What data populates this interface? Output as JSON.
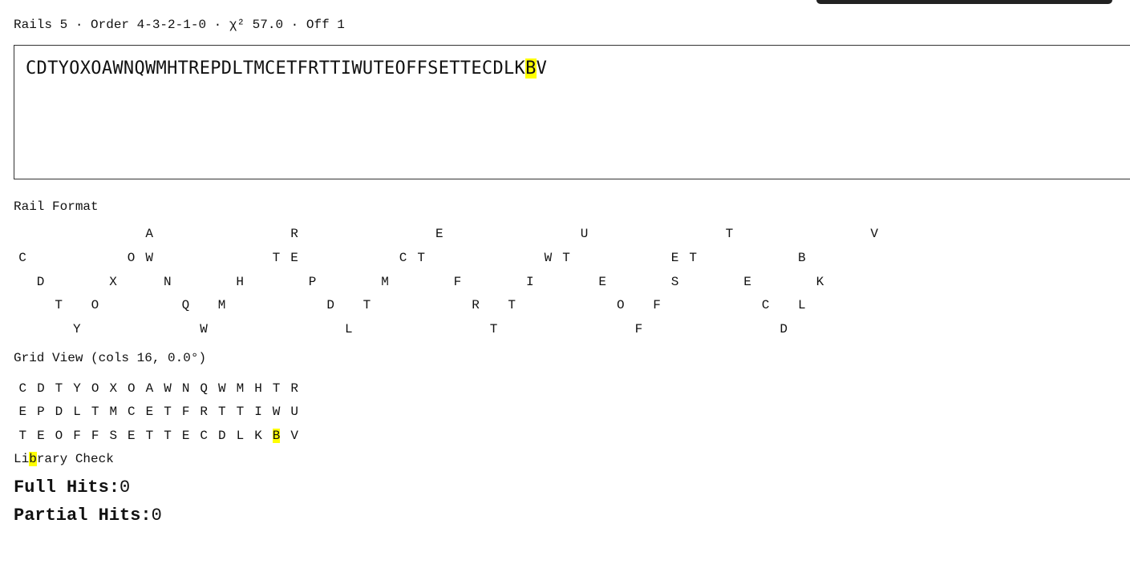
{
  "status": {
    "text": "Rails 5 · Order 4-3-2-1-0 · χ² 57.0 · Off 1"
  },
  "ciphertext": {
    "before": "CDTYOXOAWNQWMHTREPDLTMCETFRTTIWUTEOFFSETTECDLK",
    "highlight": "B",
    "after": "V"
  },
  "rail_format": {
    "label": "Rail Format",
    "rails": [
      [
        null,
        null,
        null,
        null,
        null,
        null,
        null,
        "A",
        null,
        null,
        null,
        null,
        null,
        null,
        null,
        "R",
        null,
        null,
        null,
        null,
        null,
        null,
        null,
        "E",
        null,
        null,
        null,
        null,
        null,
        null,
        null,
        "U",
        null,
        null,
        null,
        null,
        null,
        null,
        null,
        "T",
        null,
        null,
        null,
        null,
        null,
        null,
        null,
        "V"
      ],
      [
        "C",
        null,
        null,
        null,
        null,
        null,
        "O",
        "W",
        null,
        null,
        null,
        null,
        null,
        null,
        "T",
        "E",
        null,
        null,
        null,
        null,
        null,
        "C",
        "T",
        null,
        null,
        null,
        null,
        null,
        null,
        "W",
        "T",
        null,
        null,
        null,
        null,
        null,
        "E",
        "T",
        null,
        null,
        null,
        null,
        null,
        "B"
      ],
      [
        null,
        "D",
        null,
        null,
        null,
        "X",
        null,
        null,
        "N",
        null,
        null,
        null,
        "H",
        null,
        null,
        null,
        "P",
        null,
        null,
        null,
        "M",
        null,
        null,
        null,
        "F",
        null,
        null,
        null,
        "I",
        null,
        null,
        null,
        "E",
        null,
        null,
        null,
        "S",
        null,
        null,
        null,
        "E",
        null,
        null,
        null,
        "K"
      ],
      [
        null,
        null,
        "T",
        null,
        "O",
        null,
        null,
        null,
        null,
        "Q",
        null,
        "M",
        null,
        null,
        null,
        null,
        null,
        "D",
        null,
        "T",
        null,
        null,
        null,
        null,
        null,
        "R",
        null,
        "T",
        null,
        null,
        null,
        null,
        null,
        "O",
        null,
        "F",
        null,
        null,
        null,
        null,
        null,
        "C",
        null,
        "L"
      ],
      [
        null,
        null,
        null,
        "Y",
        null,
        null,
        null,
        null,
        null,
        null,
        "W",
        null,
        null,
        null,
        null,
        null,
        null,
        null,
        "L",
        null,
        null,
        null,
        null,
        null,
        null,
        null,
        "T",
        null,
        null,
        null,
        null,
        null,
        null,
        null,
        "F",
        null,
        null,
        null,
        null,
        null,
        null,
        null,
        "D"
      ]
    ],
    "highlight_rail": 1,
    "highlight_col": 46
  },
  "grid_view": {
    "label": "Grid View (cols 16, 0.0°)",
    "rows": [
      [
        "C",
        "D",
        "T",
        "Y",
        "O",
        "X",
        "O",
        "A",
        "W",
        "N",
        "Q",
        "W",
        "M",
        "H",
        "T",
        "R"
      ],
      [
        "E",
        "P",
        "D",
        "L",
        "T",
        "M",
        "C",
        "E",
        "T",
        "F",
        "R",
        "T",
        "T",
        "I",
        "W",
        "U"
      ],
      [
        "T",
        "E",
        "O",
        "F",
        "F",
        "S",
        "E",
        "T",
        "T",
        "E",
        "C",
        "D",
        "L",
        "K",
        "B",
        "V"
      ]
    ],
    "highlight_row": 2,
    "highlight_col": 14
  },
  "library_check": {
    "label_a": "Li",
    "label_hl": "b",
    "label_b": "rary Check",
    "full_hits_label": "Full Hits:",
    "full_hits_value": "0",
    "partial_hits_label": "Partial Hits:",
    "partial_hits_value": "0"
  },
  "colors": {
    "highlight": "#ffff00",
    "text": "#111111",
    "border": "#333333"
  }
}
